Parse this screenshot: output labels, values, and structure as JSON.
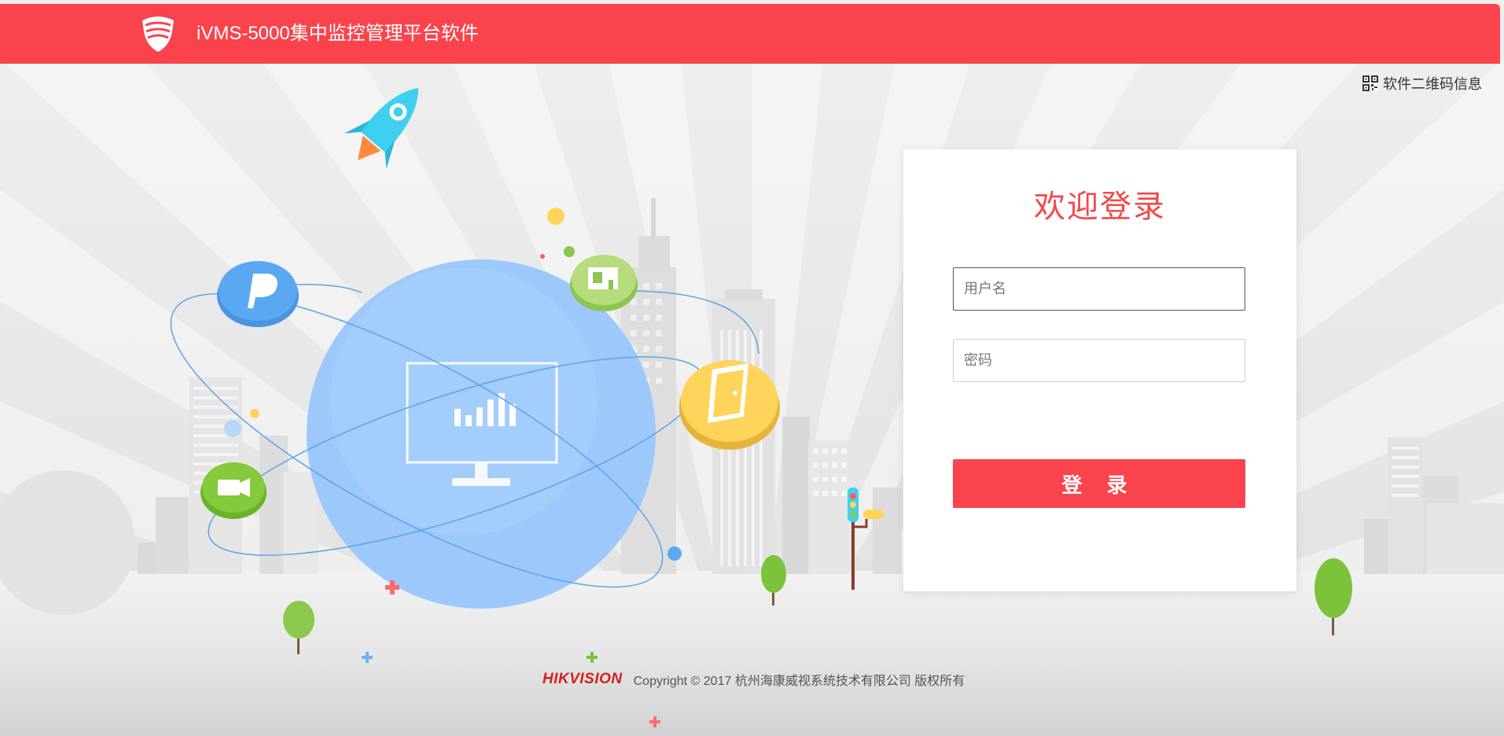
{
  "app": {
    "title": "iVMS-5000集中监控管理平台软件",
    "logo": "hikvision-shield-logo"
  },
  "topbar": {
    "qr_label": "软件二维码信息",
    "qr_icon": "qr-code-icon"
  },
  "login": {
    "heading": "欢迎登录",
    "username_placeholder": "用户名",
    "password_placeholder": "密码",
    "submit_label": "登 录"
  },
  "footer": {
    "brand": "HIKVISION",
    "copyright": "Copyright © 2017 杭州海康威视系统技术有限公司 版权所有"
  },
  "colors": {
    "accent": "#fa434c",
    "heading": "#f24a4a",
    "globe": "#9cc8fb"
  },
  "illustration": {
    "icons": [
      "rocket-icon",
      "parking-icon",
      "camera-icon",
      "monitor-chart-icon",
      "presentation-icon",
      "door-icon",
      "traffic-light-icon",
      "tree-icon"
    ]
  }
}
